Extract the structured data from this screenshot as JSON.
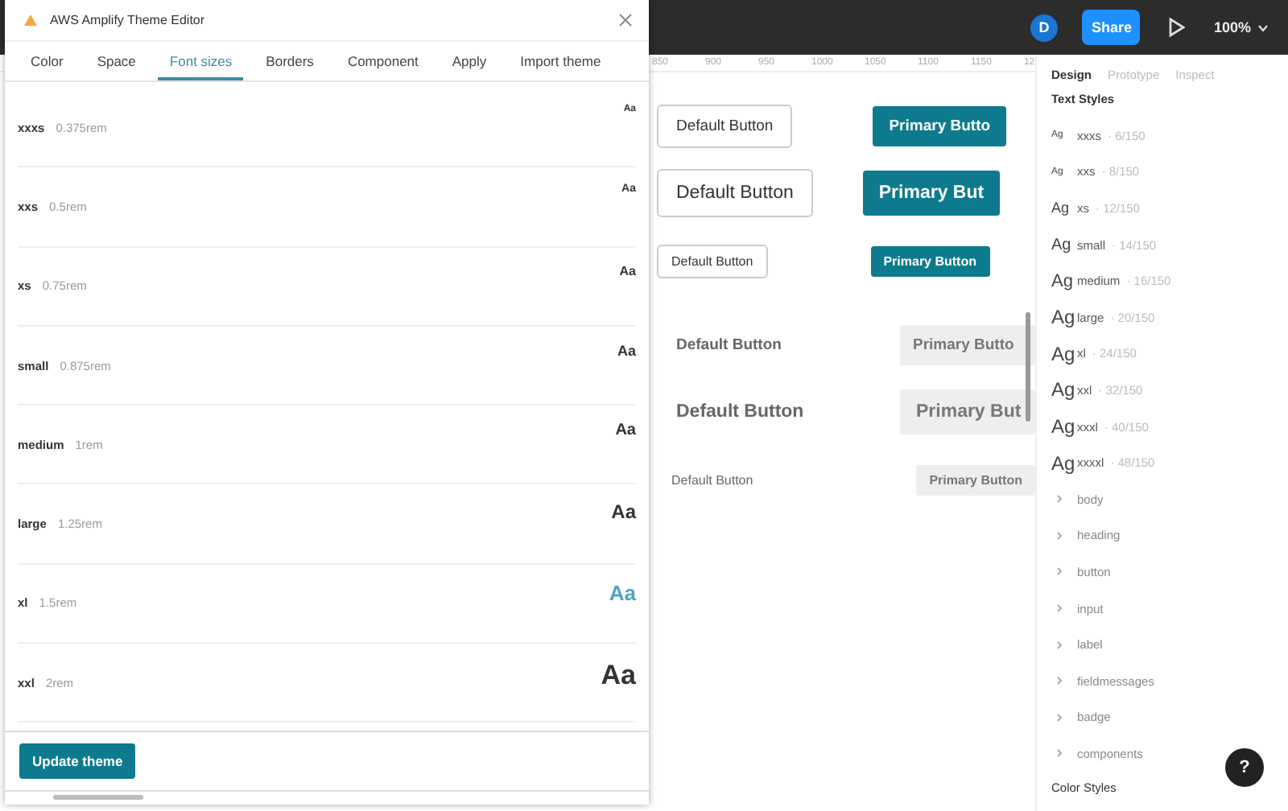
{
  "topbar": {
    "avatar": "D",
    "share": "Share",
    "zoom": "100%"
  },
  "plugin": {
    "title": "AWS Amplify Theme Editor",
    "tabs": [
      {
        "label": "Color",
        "selected": false
      },
      {
        "label": "Space",
        "selected": false
      },
      {
        "label": "Font sizes",
        "selected": true
      },
      {
        "label": "Borders",
        "selected": false
      },
      {
        "label": "Component",
        "selected": false
      },
      {
        "label": "Apply",
        "selected": false
      },
      {
        "label": "Import theme",
        "selected": false
      }
    ],
    "font_sizes": [
      {
        "name": "xxxs",
        "value": "0.375rem",
        "preview": "Aa",
        "highlighted": false
      },
      {
        "name": "xxs",
        "value": "0.5rem",
        "preview": "Aa",
        "highlighted": false
      },
      {
        "name": "xs",
        "value": "0.75rem",
        "preview": "Aa",
        "highlighted": false
      },
      {
        "name": "small",
        "value": "0.875rem",
        "preview": "Aa",
        "highlighted": false
      },
      {
        "name": "medium",
        "value": "1rem",
        "preview": "Aa",
        "highlighted": false
      },
      {
        "name": "large",
        "value": "1.25rem",
        "preview": "Aa",
        "highlighted": false
      },
      {
        "name": "xl",
        "value": "1.5rem",
        "preview": "Aa",
        "highlighted": true
      },
      {
        "name": "xxl",
        "value": "2rem",
        "preview": "Aa",
        "highlighted": false
      }
    ],
    "update_button": "Update theme"
  },
  "ruler": [
    "850",
    "900",
    "950",
    "1000",
    "1050",
    "1100",
    "1150",
    "12"
  ],
  "canvas_rows": [
    {
      "kind": "outlined",
      "default": "Default Button",
      "primary": "Primary Butto"
    },
    {
      "kind": "outlined",
      "default": "Default Button",
      "primary": "Primary But"
    },
    {
      "kind": "outlined",
      "default": "Default Button",
      "primary": "Primary Button"
    },
    {
      "kind": "ghost",
      "default": "Default Button",
      "primary": "Primary Butto"
    },
    {
      "kind": "ghost",
      "default": "Default Button",
      "primary": "Primary But"
    },
    {
      "kind": "ghost",
      "default": "Default Button",
      "primary": "Primary Button"
    }
  ],
  "panel": {
    "tabs": [
      {
        "label": "Design",
        "selected": true
      },
      {
        "label": "Prototype",
        "selected": false
      },
      {
        "label": "Inspect",
        "selected": false
      }
    ],
    "text_styles_title": "Text Styles",
    "text_styles": [
      {
        "icon": "Ag",
        "name": "xxxs",
        "info": "· 6/150"
      },
      {
        "icon": "Ag",
        "name": "xxs",
        "info": "· 8/150"
      },
      {
        "icon": "Ag",
        "name": "xs",
        "info": "· 12/150"
      },
      {
        "icon": "Ag",
        "name": "small",
        "info": "· 14/150"
      },
      {
        "icon": "Ag",
        "name": "medium",
        "info": "· 16/150"
      },
      {
        "icon": "Ag",
        "name": "large",
        "info": "· 20/150"
      },
      {
        "icon": "Ag",
        "name": "xl",
        "info": "· 24/150"
      },
      {
        "icon": "Ag",
        "name": "xxl",
        "info": "· 32/150"
      },
      {
        "icon": "Ag",
        "name": "xxxl",
        "info": "· 40/150"
      },
      {
        "icon": "Ag",
        "name": "xxxxl",
        "info": "· 48/150"
      }
    ],
    "groups": [
      "body",
      "heading",
      "button",
      "input",
      "label",
      "fieldmessages",
      "badge",
      "components"
    ],
    "color_styles_title": "Color Styles"
  },
  "help": "?"
}
